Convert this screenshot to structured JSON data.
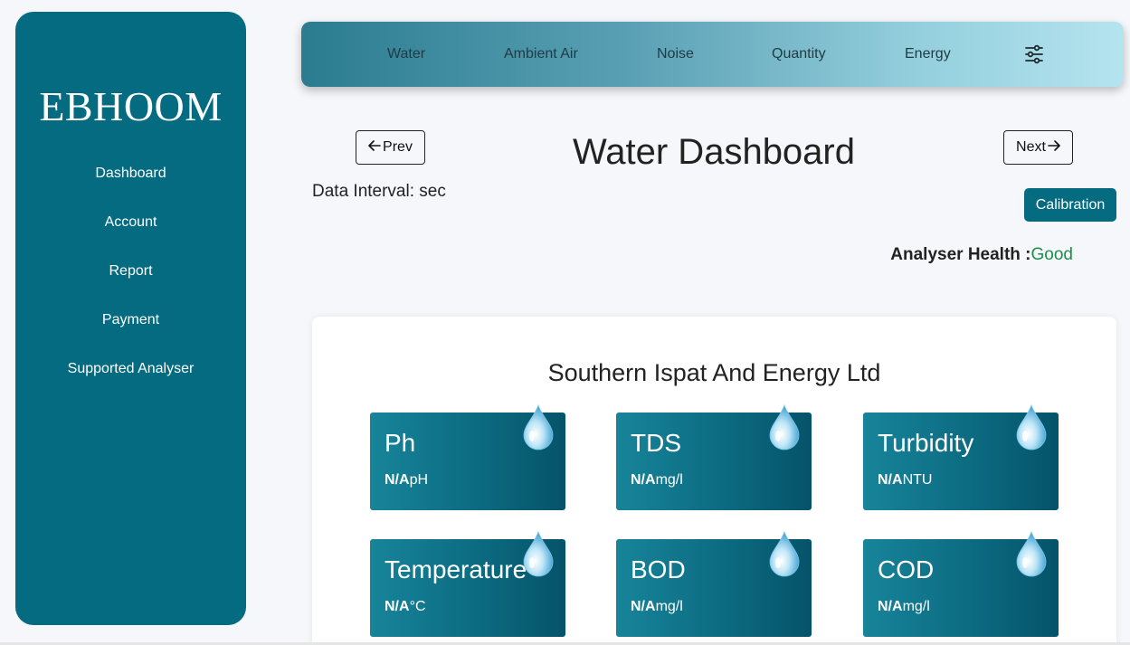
{
  "sidebar": {
    "brand": "EBHOOM",
    "items": [
      {
        "label": "Dashboard"
      },
      {
        "label": "Account"
      },
      {
        "label": "Report"
      },
      {
        "label": "Payment"
      },
      {
        "label": "Supported Analyser"
      }
    ]
  },
  "topbar": {
    "tabs": [
      {
        "label": "Water"
      },
      {
        "label": "Ambient Air"
      },
      {
        "label": "Noise"
      },
      {
        "label": "Quantity"
      },
      {
        "label": "Energy"
      }
    ],
    "filter_icon": "sliders-icon"
  },
  "header": {
    "prev_label": "Prev",
    "next_label": "Next",
    "title": "Water Dashboard",
    "interval_label": "Data Interval: sec",
    "calibration_label": "Calibration",
    "health_label": "Analyser Health :",
    "health_value": "Good"
  },
  "company": "Southern Ispat And Energy Ltd",
  "parameters": [
    {
      "name": "Ph",
      "value": "N/A",
      "unit": "pH"
    },
    {
      "name": "TDS",
      "value": "N/A",
      "unit": "mg/l"
    },
    {
      "name": "Turbidity",
      "value": "N/A",
      "unit": "NTU"
    },
    {
      "name": "Temperature",
      "value": "N/A",
      "unit": "°C"
    },
    {
      "name": "BOD",
      "value": "N/A",
      "unit": "mg/l"
    },
    {
      "name": "COD",
      "value": "N/A",
      "unit": "mg/l"
    }
  ],
  "colors": {
    "primary": "#046b80",
    "good": "#1a9048"
  }
}
